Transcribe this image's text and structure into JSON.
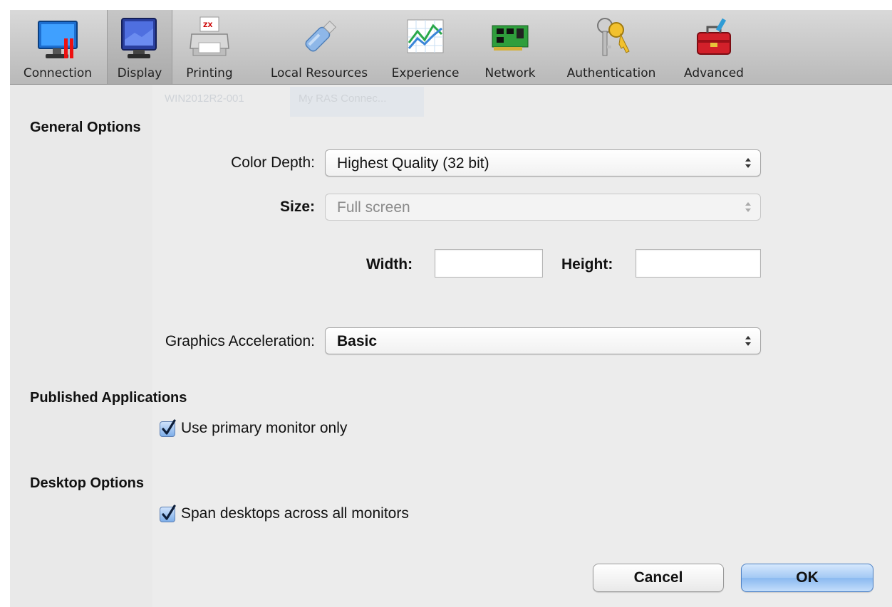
{
  "toolbar": {
    "tabs": [
      {
        "label": "Connection",
        "icon": "monitor-plug-icon"
      },
      {
        "label": "Display",
        "icon": "display-monitor-icon",
        "selected": true
      },
      {
        "label": "Printing",
        "icon": "printer-icon"
      },
      {
        "label": "Local Resources",
        "icon": "usb-drive-icon"
      },
      {
        "label": "Experience",
        "icon": "graph-icon"
      },
      {
        "label": "Network",
        "icon": "network-card-icon"
      },
      {
        "label": "Authentication",
        "icon": "keys-icon"
      },
      {
        "label": "Advanced",
        "icon": "toolbox-icon"
      }
    ]
  },
  "background": {
    "row_cells": [
      "WIN2012R2-001",
      "My RAS Connec..."
    ]
  },
  "general": {
    "title": "General Options",
    "color_depth_label": "Color Depth:",
    "color_depth_value": "Highest Quality (32 bit)",
    "size_label": "Size:",
    "size_value": "Full screen",
    "width_label": "Width:",
    "width_value": "",
    "height_label": "Height:",
    "height_value": "",
    "graphics_label": "Graphics Acceleration:",
    "graphics_value": "Basic"
  },
  "published": {
    "title": "Published Applications",
    "primary_monitor_label": "Use primary monitor only",
    "primary_monitor_checked": true
  },
  "desktop": {
    "title": "Desktop Options",
    "span_label": "Span desktops across all monitors",
    "span_checked": true
  },
  "buttons": {
    "cancel": "Cancel",
    "ok": "OK"
  },
  "colors": {
    "accent_blue": "#8ab9f0",
    "window_bg": "#ececec"
  }
}
